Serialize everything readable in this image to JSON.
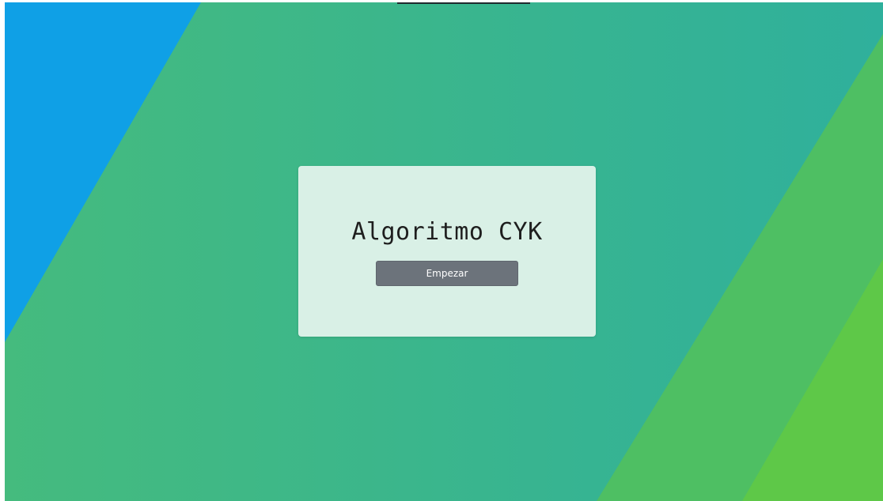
{
  "page": {
    "title": "Algoritmo CYK"
  },
  "actions": {
    "start_label": "Empezar"
  },
  "colors": {
    "background_main": "#3fba86",
    "background_blue": "#0fa0e6",
    "background_green": "#4ebf63",
    "background_lime": "#5ec848",
    "card": "#d9f0e6",
    "button": "#6c737b",
    "button_text": "#ffffff",
    "title_text": "#1e1e1e"
  }
}
